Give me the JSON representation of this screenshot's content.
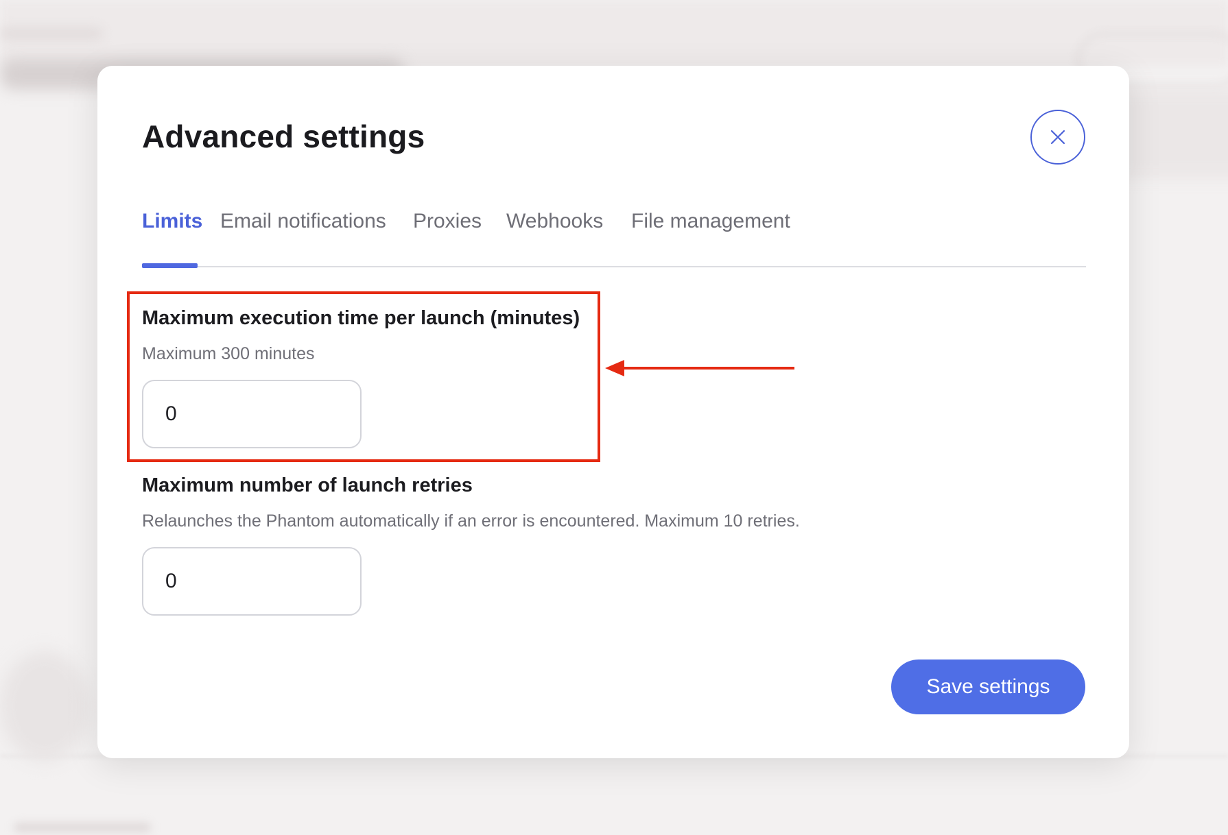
{
  "modal": {
    "title": "Advanced settings",
    "close_icon": "close-icon"
  },
  "tabs": [
    {
      "label": "Limits",
      "active": true
    },
    {
      "label": "Email notifications",
      "active": false
    },
    {
      "label": "Proxies",
      "active": false
    },
    {
      "label": "Webhooks",
      "active": false
    },
    {
      "label": "File management",
      "active": false
    }
  ],
  "fields": {
    "execution_time": {
      "title": "Maximum execution time per launch (minutes)",
      "description": "Maximum 300 minutes",
      "value": "0"
    },
    "launch_retries": {
      "title": "Maximum number of launch retries",
      "description": "Relaunches the Phantom automatically if an error is encountered. Maximum 10 retries.",
      "value": "0"
    }
  },
  "actions": {
    "save_label": "Save settings"
  },
  "annotation": {
    "highlight_color": "#e52a12",
    "arrow_icon": "arrow-left-icon"
  },
  "colors": {
    "accent": "#4f6ee6",
    "tab_active": "#4a61d8"
  }
}
